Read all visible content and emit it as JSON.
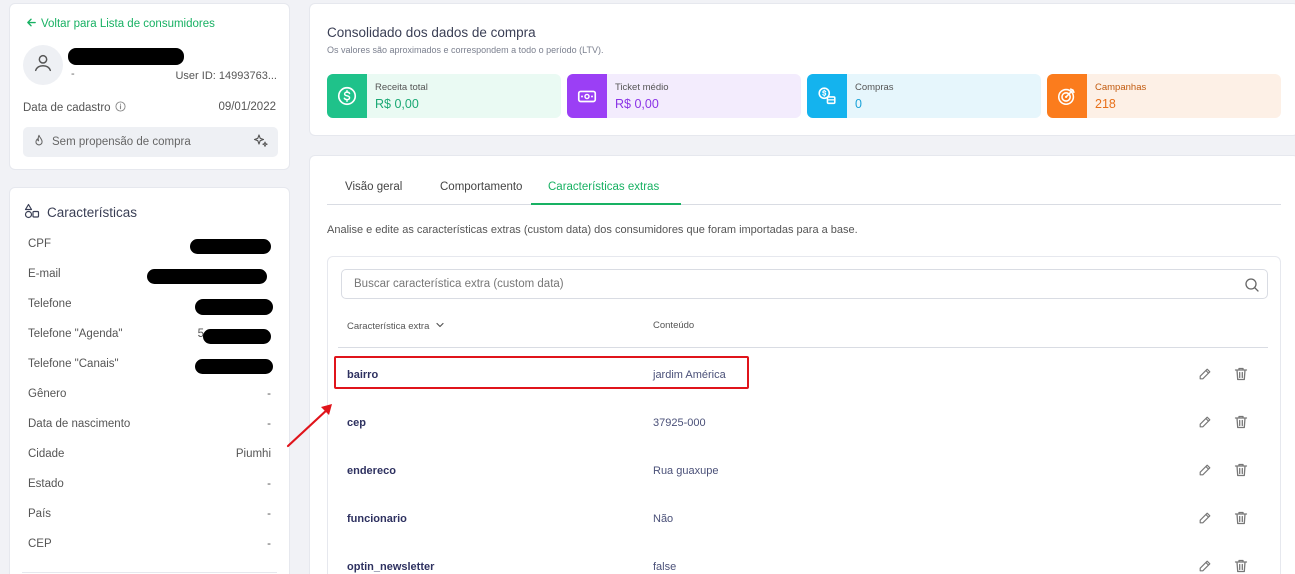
{
  "profile": {
    "back_link": "Voltar para Lista de consumidores",
    "name_dash": "-",
    "user_id": "User ID: 14993763...",
    "registration_label": "Data de cadastro",
    "registration_date": "09/01/2022",
    "propensity": "Sem propensão de compra"
  },
  "characteristics": {
    "title": "Características",
    "rows": [
      {
        "label": "CPF",
        "value": ""
      },
      {
        "label": "E-mail",
        "value": ""
      },
      {
        "label": "Telefone",
        "value": ""
      },
      {
        "label": "Telefone \"Agenda\"",
        "value": "5"
      },
      {
        "label": "Telefone \"Canais\"",
        "value": ""
      },
      {
        "label": "Gênero",
        "value": "-"
      },
      {
        "label": "Data de nascimento",
        "value": "-"
      },
      {
        "label": "Cidade",
        "value": "Piumhi"
      },
      {
        "label": "Estado",
        "value": "-"
      },
      {
        "label": "País",
        "value": "-"
      },
      {
        "label": "CEP",
        "value": "-"
      }
    ]
  },
  "summary": {
    "title": "Consolidado dos dados de compra",
    "subtitle": "Os valores são aproximados e correspondem a todo o período (LTV).",
    "kpis": [
      {
        "label": "Receita total",
        "value": "R$ 0,00",
        "icon": "dollar-circle-icon",
        "accent": "#1fc28a",
        "bg": "#eafaf3",
        "text_color": "#1aa874"
      },
      {
        "label": "Ticket médio",
        "value": "R$ 0,00",
        "icon": "banknote-icon",
        "accent": "#9b3ff5",
        "bg": "#f3ecfd",
        "text_color": "#8a33e6"
      },
      {
        "label": "Compras",
        "value": "0",
        "icon": "coins-icon",
        "accent": "#14b3ee",
        "bg": "#e6f6fc",
        "text_color": "#1aa2d8"
      },
      {
        "label": "Campanhas",
        "value": "218",
        "icon": "target-icon",
        "accent": "#fb7c1d",
        "bg": "#fdf0e6",
        "text_color": "#e8701a"
      }
    ]
  },
  "tabs": [
    "Visão geral",
    "Comportamento",
    "Características extras"
  ],
  "active_tab": "Características extras",
  "description": "Analise e edite as características extras (custom data) dos consumidores que foram importadas para a base.",
  "search": {
    "placeholder": "Buscar característica extra (custom data)"
  },
  "table": {
    "headers": [
      "Característica extra",
      "Conteúdo"
    ],
    "rows": [
      {
        "key": "bairro",
        "value": "jardim América"
      },
      {
        "key": "cep",
        "value": "37925-000"
      },
      {
        "key": "endereco",
        "value": "Rua guaxupe"
      },
      {
        "key": "funcionario",
        "value": "Não"
      },
      {
        "key": "optin_newsletter",
        "value": "false"
      }
    ]
  },
  "colors": {
    "brand": "#18b163",
    "highlight": "#e0141b"
  }
}
